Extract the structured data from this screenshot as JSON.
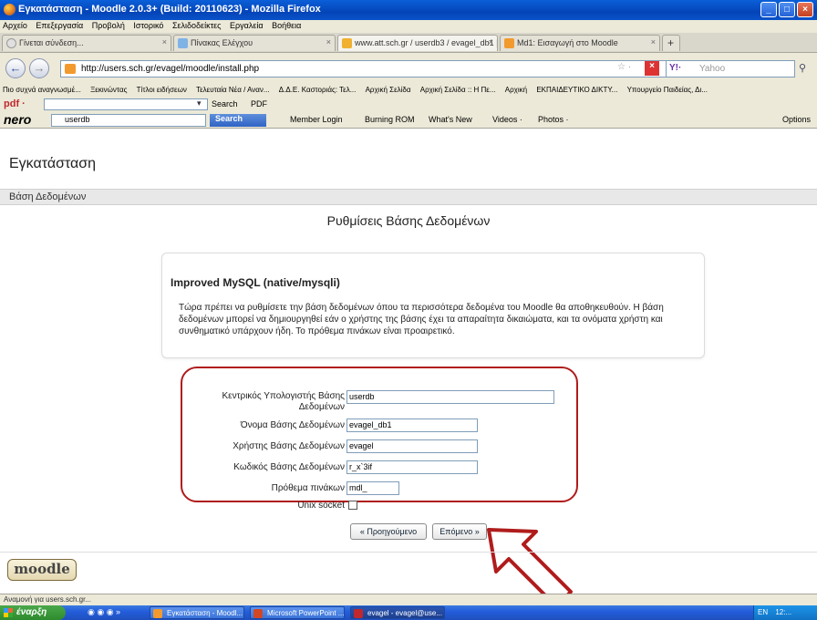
{
  "window": {
    "title": "Εγκατάσταση - Moodle 2.0.3+ (Build: 20110623) - Mozilla Firefox",
    "controls": {
      "minimize": "_",
      "maximize": "□",
      "close": "×"
    }
  },
  "menubar": [
    "Αρχείο",
    "Επεξεργασία",
    "Προβολή",
    "Ιστορικό",
    "Σελιδοδείκτες",
    "Εργαλεία",
    "Βοήθεια"
  ],
  "tabs": [
    {
      "label": "Γίνεται σύνδεση...",
      "active": false
    },
    {
      "label": "Πίνακας Ελέγχου",
      "active": false
    },
    {
      "label": "www.att.sch.gr / userdb3 / evagel_db1 | ...",
      "active": true
    },
    {
      "label": "Md1: Εισαγωγή στο Moodle",
      "active": false
    }
  ],
  "tab_add": "+",
  "nav": {
    "back": "←",
    "forward": "→",
    "url": "http://users.sch.gr/evagel/moodle/install.php",
    "search_placeholder": "Yahoo"
  },
  "bookmarks": [
    "Πιο συχνά αναγνωσμέ...",
    "Ξεκινώντας",
    "Τίτλοι ειδήσεων",
    "Τελευταία Νέα / Αναν...",
    "Δ.Δ.Ε. Καστοριάς: Τελ...",
    "Αρχική Σελίδα",
    "Αρχική Σελίδα :: Η Πε...",
    "Αρχική",
    "ΕΚΠΑΙΔΕΥΤΙΚΟ ΔΙΚΤΥ...",
    "Υπουργείο Παιδείας, Δι..."
  ],
  "pdfbar": {
    "label": "pdf ·",
    "search_label": "Search",
    "pdf": "PDF"
  },
  "nerobar": {
    "brand": "nero",
    "search_value": "userdb",
    "search_button": "Search",
    "items": [
      "Member Login",
      "Burning ROM",
      "What's New",
      "Videos ·",
      "Photos ·"
    ],
    "options": "Options"
  },
  "page": {
    "heading": "Εγκατάσταση",
    "breadcrumb": "Βάση Δεδομένων",
    "section_title": "Ρυθμίσεις Βάσης Δεδομένων",
    "info_title": "Improved MySQL (native/mysqli)",
    "info_text": "Τώρα πρέπει να ρυθμίσετε την βάση δεδομένων όπου τα περισσότερα δεδομένα του Moodle θα αποθηκευθούν. Η βάση δεδομένων μπορεί να δημιουργηθεί εάν ο χρήστης της βάσης έχει τα απαραίτητα δικαιώματα, και τα ονόματα χρήστη και συνθηματικό υπάρχουν ήδη. Το πρόθεμα πινάκων είναι προαιρετικό.",
    "form": {
      "host_label_1": "Κεντρικός Υπολογιστής Βάσης",
      "host_label_2": "Δεδομένων",
      "host_value": "userdb",
      "dbname_label": "Όνομα Βάσης Δεδομένων",
      "dbname_value": "evagel_db1",
      "dbuser_label": "Χρήστης Βάσης Δεδομένων",
      "dbuser_value": "evagel",
      "dbpass_label": "Κωδικός Βάσης Δεδομένων",
      "dbpass_value": "r_x`3if",
      "prefix_label": "Πρόθεμα πινάκων",
      "prefix_value": "mdl_",
      "socket_label": "Unix socket",
      "socket_checked": false
    },
    "prev_button": "« Προηγούμενο",
    "next_button": "Επόμενο »",
    "logo": "moodle"
  },
  "statusbar": "Αναμονή για users.sch.gr...",
  "taskbar": {
    "start": "έναρξη",
    "tasks": [
      {
        "label": "Εγκατάσταση - Moodl...",
        "active": false
      },
      {
        "label": "Microsoft PowerPoint ...",
        "active": false
      },
      {
        "label": "evagel - evagel@use...",
        "active": true
      }
    ],
    "tray_lang": "EN",
    "tray_time": "12:..."
  },
  "colors": {
    "annotation_red": "#b01c1c",
    "title_blue": "#0a52c8",
    "xp_green": "#2d8a2d"
  }
}
